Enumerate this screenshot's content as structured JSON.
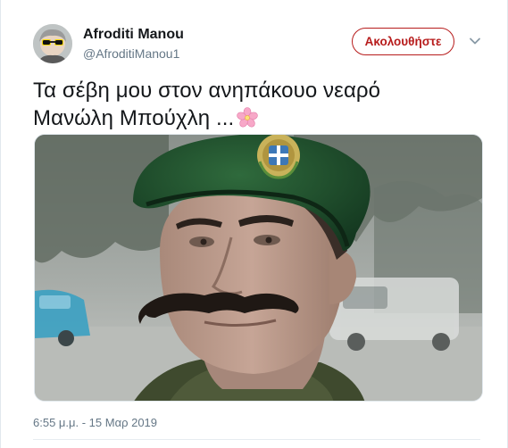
{
  "user": {
    "display_name": "Afroditi Manou",
    "handle": "@AfroditiManou1"
  },
  "actions": {
    "follow_label": "Ακολουθήστε"
  },
  "tweet": {
    "text_line1": "Τα σέβη μου στον ανηπάκουο νεαρό",
    "text_line2": "Μανώλη Μπούχλη ...",
    "emoji": "cherry-blossom"
  },
  "meta": {
    "timestamp": "6:55 μ.μ. - 15 Μαρ 2019"
  },
  "colors": {
    "follow_accent": "#b71c1c",
    "secondary_text": "#657786",
    "primary_text": "#14171a",
    "beret_green": "#1f4a2a"
  }
}
